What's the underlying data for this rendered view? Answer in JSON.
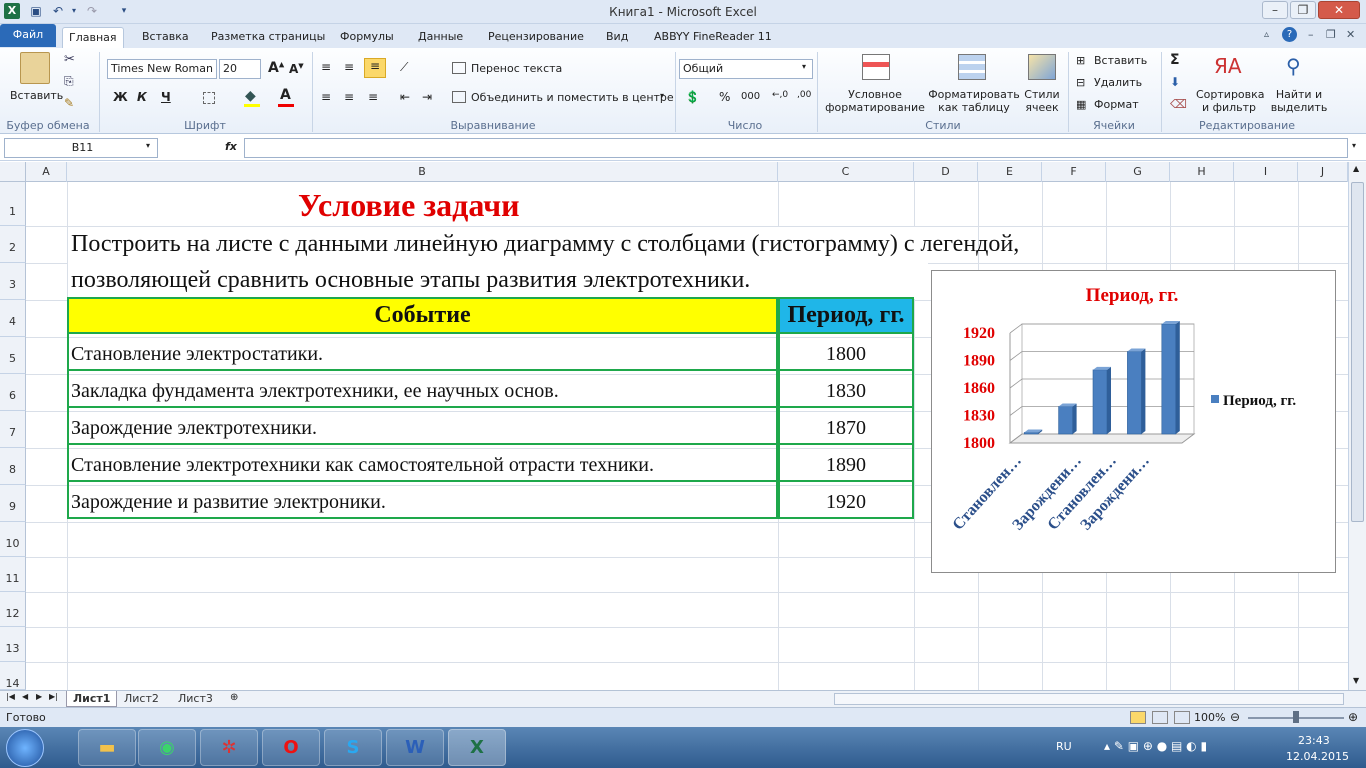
{
  "window": {
    "title": "Книга1  -  Microsoft Excel"
  },
  "quick_access": [
    "save-icon",
    "undo-icon",
    "redo-icon",
    "customize-icon"
  ],
  "tabs": [
    "Файл",
    "Главная",
    "Вставка",
    "Разметка страницы",
    "Формулы",
    "Данные",
    "Рецензирование",
    "Вид",
    "ABBYY FineReader 11"
  ],
  "ribbon": {
    "clipboard": {
      "paste": "Вставить",
      "label": "Буфер обмена"
    },
    "font": {
      "name": "Times New Roman",
      "size": "20",
      "bold": "Ж",
      "italic": "К",
      "underline": "Ч",
      "label": "Шрифт"
    },
    "alignment": {
      "wrap": "Перенос текста",
      "merge": "Объединить и поместить в центре",
      "label": "Выравнивание"
    },
    "number": {
      "format": "Общий",
      "label": "Число"
    },
    "styles": {
      "conditional": "Условное\nформатирование",
      "format_table": "Форматировать\nкак таблицу",
      "cell_styles": "Стили\nячеек",
      "label": "Стили"
    },
    "cells": {
      "insert": "Вставить",
      "delete": "Удалить",
      "format": "Формат",
      "label": "Ячейки"
    },
    "editing": {
      "sort": "Сортировка\nи фильтр",
      "find": "Найти и\nвыделить",
      "label": "Редактирование"
    }
  },
  "formula_bar": {
    "name_box": "B11",
    "fx": "fx",
    "value": ""
  },
  "columns": [
    "A",
    "B",
    "C",
    "D",
    "E",
    "F",
    "G",
    "H",
    "I",
    "J"
  ],
  "rows": [
    "1",
    "2",
    "3",
    "4",
    "5",
    "6",
    "7",
    "8",
    "9",
    "10",
    "11",
    "12",
    "13",
    "14"
  ],
  "sheet": {
    "title": "Условие задачи",
    "task_line1": "Построить на листе с данными линейную диаграмму с столбцами (гистограмму) с легендой,",
    "task_line2": "позволяющей сравнить основные этапы развития электротехники.",
    "table": {
      "headers": [
        "Событие",
        "Период, гг."
      ],
      "rows": [
        [
          "Становление электростатики.",
          "1800"
        ],
        [
          "Закладка фундамента электротехники, ее научных основ.",
          "1830"
        ],
        [
          "Зарождение электротехники.",
          "1870"
        ],
        [
          "Становление электротехники как самостоятельной отрасти техники.",
          "1890"
        ],
        [
          "Зарождение и развитие электроники.",
          "1920"
        ]
      ]
    }
  },
  "chart_data": {
    "type": "bar",
    "title": "Период, гг.",
    "categories": [
      "Становлен…",
      "Зарождени…",
      "Становлен…",
      "Зарождени…"
    ],
    "series": [
      {
        "name": "Период, гг.",
        "values": [
          1800,
          1830,
          1870,
          1890,
          1920
        ]
      }
    ],
    "yticks": [
      "1920",
      "1890",
      "1860",
      "1830",
      "1800"
    ],
    "ylim": [
      1800,
      1920
    ],
    "legend": "right",
    "color": "#4a7fc0"
  },
  "sheets": [
    "Лист1",
    "Лист2",
    "Лист3"
  ],
  "status": {
    "ready": "Готово",
    "zoom": "100%"
  },
  "taskbar": {
    "lang": "RU",
    "time": "23:43",
    "date": "12.04.2015"
  }
}
